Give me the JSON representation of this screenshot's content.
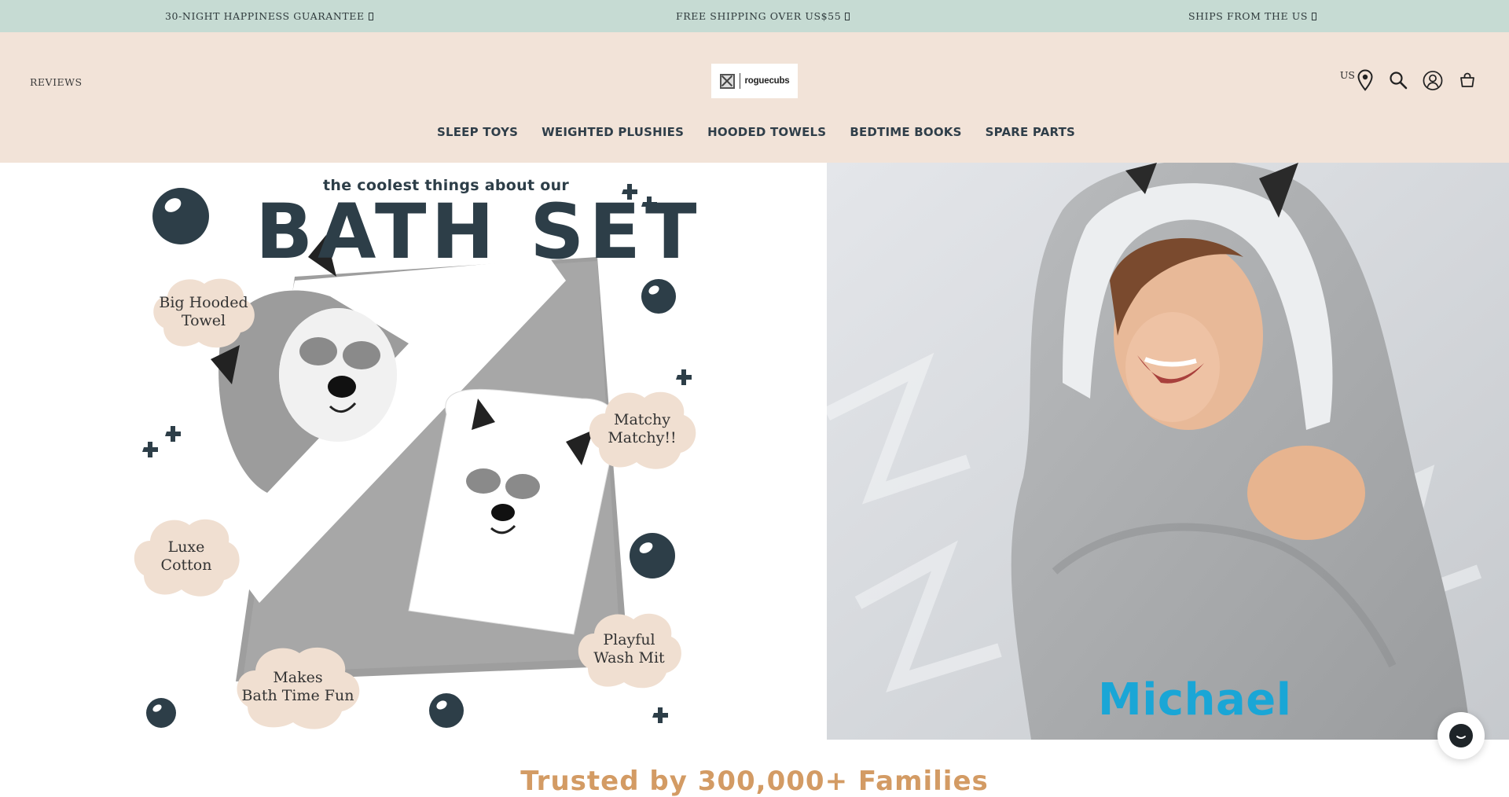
{
  "announcement": {
    "items": [
      {
        "text": "30-NIGHT HAPPINESS GUARANTEE"
      },
      {
        "text": "FREE SHIPPING OVER US$55"
      },
      {
        "text": "SHIPS FROM THE US"
      }
    ]
  },
  "header": {
    "reviews_label": "REVIEWS",
    "logo_text": "roguecubs",
    "country_label": "US",
    "icons": [
      "location-pin-icon",
      "search-icon",
      "account-icon",
      "cart-icon"
    ]
  },
  "nav": {
    "items": [
      {
        "label": "SLEEP TOYS"
      },
      {
        "label": "WEIGHTED PLUSHIES"
      },
      {
        "label": "HOODED TOWELS"
      },
      {
        "label": "BEDTIME BOOKS"
      },
      {
        "label": "SPARE PARTS"
      }
    ]
  },
  "hero": {
    "subtitle": "the coolest things about our",
    "title": "BATH SET",
    "callouts": [
      {
        "text": "Big Hooded\nTowel"
      },
      {
        "text": "Matchy\nMatchy!!"
      },
      {
        "text": "Luxe\nCotton"
      },
      {
        "text": "Playful\nWash Mit"
      },
      {
        "text": "Makes\nBath Time Fun"
      }
    ],
    "photo_name": "Michael"
  },
  "trusted_heading": "Trusted by 300,000+ Families",
  "colors": {
    "announcement_bg": "#c6dbd3",
    "header_bg": "#f2e3d8",
    "nav_text": "#2f3e49",
    "cloud": "#f0dfd1",
    "heading_accent": "#d39b64",
    "name_blue": "#1aa6d6"
  }
}
